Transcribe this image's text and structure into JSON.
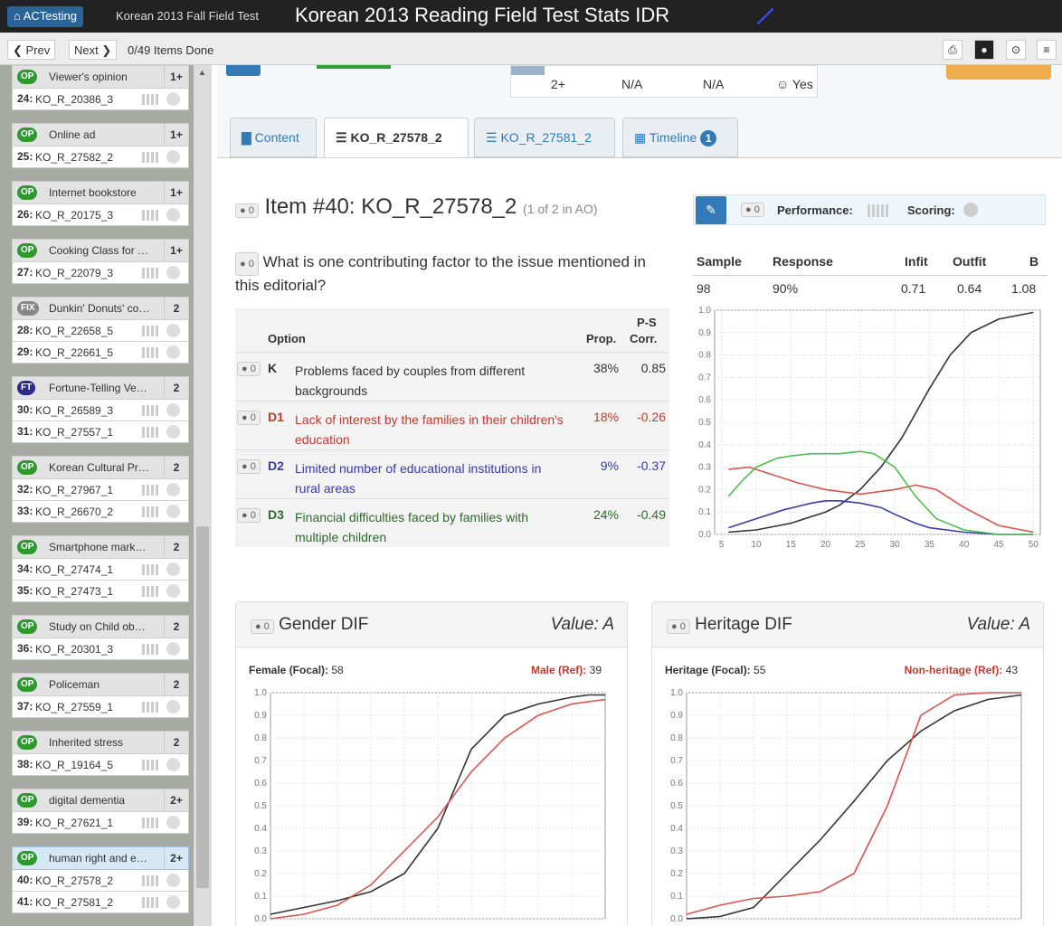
{
  "app": {
    "brand": "ACTesting",
    "subtitle": "Korean 2013 Fall Field Test",
    "title": "Korean 2013 Reading Field Test Stats IDR"
  },
  "nav": {
    "prev": "Prev",
    "next": "Next",
    "done": "0/49 Items Done"
  },
  "sidebar": {
    "groups": [
      {
        "badge": "OP",
        "name": "Viewer's opinion",
        "level": "1+",
        "items": [
          {
            "num": "24:",
            "code": "KO_R_20386_3"
          }
        ]
      },
      {
        "badge": "OP",
        "name": "Online ad",
        "level": "1+",
        "items": [
          {
            "num": "25:",
            "code": "KO_R_27582_2"
          }
        ]
      },
      {
        "badge": "OP",
        "name": "Internet bookstore",
        "level": "1+",
        "items": [
          {
            "num": "26:",
            "code": "KO_R_20175_3"
          }
        ]
      },
      {
        "badge": "OP",
        "name": "Cooking Class for …",
        "level": "1+",
        "items": [
          {
            "num": "27:",
            "code": "KO_R_22079_3"
          }
        ]
      },
      {
        "badge": "FIX",
        "name": "Dunkin' Donuts' co…",
        "level": "2",
        "items": [
          {
            "num": "28:",
            "code": "KO_R_22658_5"
          },
          {
            "num": "29:",
            "code": "KO_R_22661_5"
          }
        ]
      },
      {
        "badge": "FT",
        "name": "Fortune-Telling Ve…",
        "level": "2",
        "items": [
          {
            "num": "30:",
            "code": "KO_R_26589_3"
          },
          {
            "num": "31:",
            "code": "KO_R_27557_1"
          }
        ]
      },
      {
        "badge": "OP",
        "name": "Korean Cultural Pr…",
        "level": "2",
        "items": [
          {
            "num": "32:",
            "code": "KO_R_27967_1"
          },
          {
            "num": "33:",
            "code": "KO_R_26670_2"
          }
        ]
      },
      {
        "badge": "OP",
        "name": "Smartphone mark…",
        "level": "2",
        "items": [
          {
            "num": "34:",
            "code": "KO_R_27474_1"
          },
          {
            "num": "35:",
            "code": "KO_R_27473_1"
          }
        ]
      },
      {
        "badge": "OP",
        "name": "Study on Child ob…",
        "level": "2",
        "items": [
          {
            "num": "36:",
            "code": "KO_R_20301_3"
          }
        ]
      },
      {
        "badge": "OP",
        "name": "Policeman",
        "level": "2",
        "items": [
          {
            "num": "37:",
            "code": "KO_R_27559_1"
          }
        ]
      },
      {
        "badge": "OP",
        "name": "Inherited stress",
        "level": "2",
        "items": [
          {
            "num": "38:",
            "code": "KO_R_19164_5"
          }
        ]
      },
      {
        "badge": "OP",
        "name": "digital dementia",
        "level": "2+",
        "items": [
          {
            "num": "39:",
            "code": "KO_R_27621_1"
          }
        ]
      },
      {
        "badge": "OP",
        "name": "human right and e…",
        "level": "2+",
        "items": [
          {
            "num": "40:",
            "code": "KO_R_27578_2"
          },
          {
            "num": "41:",
            "code": "KO_R_27581_2"
          }
        ]
      }
    ]
  },
  "stats_strip": {
    "level": "2+",
    "a": "N/A",
    "b": "N/A",
    "c": "☺ Yes"
  },
  "tabs": {
    "content": "Content",
    "item1": "KO_R_27578_2",
    "item2": "KO_R_27581_2",
    "timeline": "Timeline",
    "timeline_count": "1"
  },
  "item": {
    "comment_count": "0",
    "title": "Item #40: KO_R_27578_2",
    "subtitle": "(1 of 2 in AO)",
    "question": "What is one contributing factor to the issue mentioned in this editorial?",
    "headers": {
      "option": "Option",
      "prop": "Prop.",
      "ps1": "P-S",
      "ps2": "Corr."
    },
    "options": [
      {
        "code": "K",
        "text": "Problems faced by couples from different backgrounds",
        "prop": "38%",
        "corr": "0.85",
        "color": "#333333"
      },
      {
        "code": "D1",
        "text": "Lack of interest by the families in their children's education",
        "prop": "18%",
        "corr": "-0.26",
        "color": "#c0392b"
      },
      {
        "code": "D2",
        "text": "Limited number of educational institutions in rural areas",
        "prop": "9%",
        "corr": "-0.37",
        "color": "#3a3aa8"
      },
      {
        "code": "D3",
        "text": "Financial difficulties faced by families with multiple children",
        "prop": "24%",
        "corr": "-0.49",
        "color": "#2d6a2d"
      }
    ]
  },
  "perf": {
    "performance": "Performance:",
    "scoring": "Scoring:"
  },
  "stats": {
    "headers": [
      "Sample",
      "Response",
      "Infit",
      "Outfit",
      "B"
    ],
    "values": [
      "98",
      "90%",
      "0.71",
      "0.64",
      "1.08"
    ]
  },
  "dif": {
    "gender": {
      "title": "Gender DIF",
      "value": "Value: A",
      "focal_label": "Female (Focal):",
      "focal": "58",
      "ref_label": "Male (Ref):",
      "ref": "39"
    },
    "heritage": {
      "title": "Heritage DIF",
      "value": "Value: A",
      "focal_label": "Heritage (Focal):",
      "focal": "55",
      "ref_label": "Non-heritage (Ref):",
      "ref": "43"
    }
  },
  "chart_data": [
    {
      "type": "line",
      "ylim": [
        0,
        1
      ],
      "xlim": [
        4,
        51
      ],
      "xticks": [
        5,
        10,
        15,
        20,
        25,
        30,
        35,
        40,
        45,
        50
      ],
      "yticks": [
        0.0,
        0.1,
        0.2,
        0.3,
        0.4,
        0.5,
        0.6,
        0.7,
        0.8,
        0.9,
        1.0
      ],
      "series": [
        {
          "color": "#333333",
          "x": [
            6,
            10,
            15,
            20,
            22,
            25,
            28,
            31,
            35,
            38,
            41,
            45,
            50
          ],
          "y": [
            0.01,
            0.02,
            0.05,
            0.1,
            0.13,
            0.2,
            0.3,
            0.43,
            0.65,
            0.8,
            0.9,
            0.96,
            0.99
          ]
        },
        {
          "color": "#d9534f",
          "x": [
            6,
            9,
            12,
            16,
            20,
            25,
            30,
            33,
            36,
            40,
            45,
            50
          ],
          "y": [
            0.29,
            0.3,
            0.27,
            0.23,
            0.2,
            0.18,
            0.2,
            0.22,
            0.2,
            0.12,
            0.04,
            0.01
          ]
        },
        {
          "color": "#3a3aa8",
          "x": [
            6,
            10,
            14,
            18,
            20,
            22,
            25,
            28,
            30,
            33,
            35,
            40,
            45,
            50
          ],
          "y": [
            0.03,
            0.07,
            0.11,
            0.14,
            0.15,
            0.15,
            0.14,
            0.12,
            0.09,
            0.05,
            0.03,
            0.01,
            0.0,
            0.0
          ]
        },
        {
          "color": "#4cbf4c",
          "x": [
            6,
            8,
            10,
            13,
            15,
            18,
            22,
            25,
            27,
            30,
            33,
            36,
            40,
            45,
            50
          ],
          "y": [
            0.17,
            0.24,
            0.3,
            0.34,
            0.35,
            0.36,
            0.36,
            0.37,
            0.36,
            0.3,
            0.17,
            0.07,
            0.02,
            0.0,
            0.0
          ]
        }
      ]
    },
    {
      "type": "line",
      "ylim": [
        0,
        1
      ],
      "xlim": [
        0,
        10
      ],
      "yticks": [
        0.0,
        0.1,
        0.2,
        0.3,
        0.4,
        0.5,
        0.6,
        0.7,
        0.8,
        0.9,
        1.0
      ],
      "series": [
        {
          "color": "#333333",
          "x": [
            0,
            1,
            2,
            3,
            4,
            5,
            6,
            7,
            8,
            9,
            9.5,
            10
          ],
          "y": [
            0.02,
            0.05,
            0.08,
            0.12,
            0.2,
            0.4,
            0.75,
            0.9,
            0.95,
            0.98,
            0.99,
            0.99
          ]
        },
        {
          "color": "#d9534f",
          "x": [
            0,
            1,
            2,
            3,
            4,
            5,
            6,
            7,
            8,
            9,
            10
          ],
          "y": [
            0.0,
            0.02,
            0.06,
            0.15,
            0.3,
            0.45,
            0.65,
            0.8,
            0.9,
            0.95,
            0.97
          ]
        }
      ]
    },
    {
      "type": "line",
      "ylim": [
        0,
        1
      ],
      "xlim": [
        0,
        10
      ],
      "yticks": [
        0.0,
        0.1,
        0.2,
        0.3,
        0.4,
        0.5,
        0.6,
        0.7,
        0.8,
        0.9,
        1.0
      ],
      "series": [
        {
          "color": "#333333",
          "x": [
            0,
            1,
            2,
            3,
            4,
            5,
            6,
            7,
            8,
            9,
            10
          ],
          "y": [
            0.0,
            0.01,
            0.05,
            0.2,
            0.35,
            0.52,
            0.7,
            0.83,
            0.92,
            0.97,
            0.99
          ]
        },
        {
          "color": "#d9534f",
          "x": [
            0,
            1,
            2,
            3,
            4,
            5,
            6,
            7,
            8,
            9,
            10
          ],
          "y": [
            0.02,
            0.06,
            0.09,
            0.1,
            0.12,
            0.2,
            0.5,
            0.9,
            0.99,
            1.0,
            1.0
          ]
        }
      ]
    }
  ]
}
